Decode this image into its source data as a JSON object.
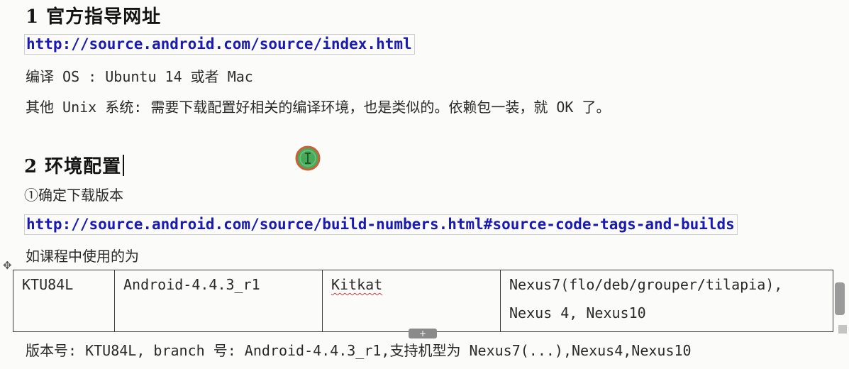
{
  "section1": {
    "heading": "1 官方指导网址",
    "link": "http://source.android.com/source/index.html",
    "os_line": "编译 OS : Ubuntu 14 或者 Mac",
    "unix_line": "其他 Unix 系统: 需要下载配置好相关的编译环境，也是类似的。依赖包一装，就 OK 了。"
  },
  "section2": {
    "heading": "2 环境配置",
    "step1": "①确定下载版本",
    "link": "http://source.android.com/source/build-numbers.html#source-code-tags-and-builds",
    "course_note": "如课程中使用的为"
  },
  "build_table": {
    "build": "KTU84L",
    "tag": "Android-4.4.3_r1",
    "version": "Kitkat",
    "devices_line1": "Nexus7(flo/deb/grouper/tilapia),",
    "devices_line2": "Nexus 4, Nexus10"
  },
  "summary_line": "版本号: KTU84L, branch 号: Android-4.4.3_r1,支持机型为 Nexus7(...),Nexus4,Nexus10",
  "icons": {
    "cursor": "text-cursor-icon",
    "move": "table-move-icon",
    "add_row": "add-row-icon",
    "scroll": "scroll-handle-icon"
  },
  "colors": {
    "link": "#1a1ab0",
    "cursor_ring": "#c8603a",
    "cursor_fill": "#4aa85a"
  }
}
